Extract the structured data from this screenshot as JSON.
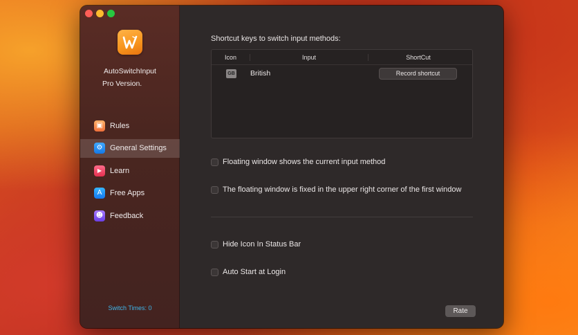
{
  "window": {
    "traffic_lights": [
      "close",
      "minimize",
      "maximize"
    ]
  },
  "sidebar": {
    "app_name": "AutoSwitchInput",
    "version": "Pro Version.",
    "items": [
      {
        "label": "Rules",
        "icon": "box-icon",
        "glyph": "▣",
        "active": false
      },
      {
        "label": "General Settings",
        "icon": "gear-icon",
        "glyph": "⚙",
        "active": true
      },
      {
        "label": "Learn",
        "icon": "play-icon",
        "glyph": "▶",
        "active": false
      },
      {
        "label": "Free Apps",
        "icon": "app-store-icon",
        "glyph": "A",
        "active": false
      },
      {
        "label": "Feedback",
        "icon": "people-icon",
        "glyph": "☻",
        "active": false
      }
    ],
    "switch_times": "Switch Times: 0"
  },
  "main": {
    "section_title": "Shortcut keys to switch input methods:",
    "table": {
      "headers": [
        "Icon",
        "Input",
        "ShortCut"
      ],
      "rows": [
        {
          "icon_badge": "GB",
          "input": "British",
          "shortcut_button": "Record shortcut"
        }
      ]
    },
    "options": [
      {
        "label": "Floating window shows the current input method",
        "checked": false
      },
      {
        "label": "The floating window is fixed in the upper right corner of the first window",
        "checked": false
      },
      {
        "label": "Hide Icon In Status Bar",
        "checked": false
      },
      {
        "label": "Auto Start at Login",
        "checked": false
      }
    ],
    "rate_button": "Rate"
  },
  "colors": {
    "accent_blue": "#3fb6ea",
    "sidebar_bg": "#4a2620",
    "main_bg": "#2e2929"
  }
}
